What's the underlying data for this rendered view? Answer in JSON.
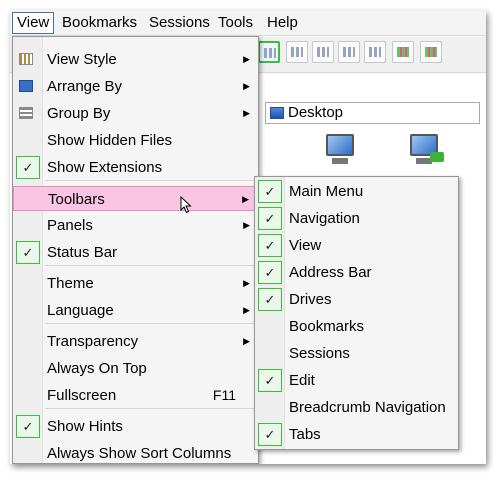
{
  "menubar": [
    "View",
    "Bookmarks",
    "Sessions",
    "Tools",
    "Help"
  ],
  "address_bar": {
    "text": "Desktop"
  },
  "view_menu": {
    "items": [
      {
        "label": "View Style",
        "submenu": true,
        "icon": "view-style-icon"
      },
      {
        "label": "Arrange By",
        "submenu": true,
        "icon": "arrange-icon"
      },
      {
        "label": "Group By",
        "submenu": true,
        "icon": "group-icon"
      },
      {
        "label": "Show Hidden Files",
        "checked": false
      },
      {
        "label": "Show Extensions",
        "checked": true
      },
      {
        "label": "Toolbars",
        "submenu": true,
        "highlighted": true
      },
      {
        "label": "Panels",
        "submenu": true
      },
      {
        "label": "Status Bar",
        "checked": true
      },
      {
        "label": "Theme",
        "submenu": true
      },
      {
        "label": "Language",
        "submenu": true
      },
      {
        "label": "Transparency",
        "submenu": true
      },
      {
        "label": "Always On Top",
        "checked": false
      },
      {
        "label": "Fullscreen",
        "shortcut": "F11"
      },
      {
        "label": "Show Hints",
        "checked": true
      },
      {
        "label": "Always Show Sort Columns",
        "checked": false
      }
    ]
  },
  "toolbars_submenu": {
    "items": [
      {
        "label": "Main Menu",
        "checked": true
      },
      {
        "label": "Navigation",
        "checked": true
      },
      {
        "label": "View",
        "checked": true
      },
      {
        "label": "Address Bar",
        "checked": true
      },
      {
        "label": "Drives",
        "checked": true
      },
      {
        "label": "Bookmarks",
        "checked": false
      },
      {
        "label": "Sessions",
        "checked": false
      },
      {
        "label": "Edit",
        "checked": true
      },
      {
        "label": "Breadcrumb Navigation",
        "checked": false
      },
      {
        "label": "Tabs",
        "checked": true
      }
    ]
  },
  "glyphs": {
    "check": "✓",
    "submenu_arrow": "▶"
  },
  "colors": {
    "highlight": "#f9c5e3",
    "check_border": "#3bbf3b"
  }
}
